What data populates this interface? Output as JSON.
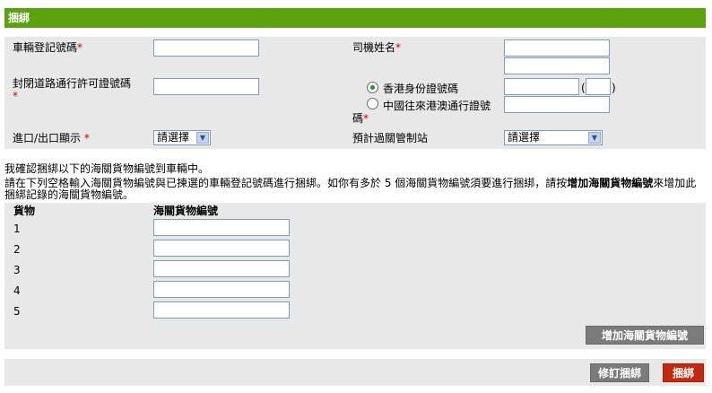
{
  "header": {
    "title": "捆綁"
  },
  "form": {
    "vehicle_reg_label": "車輛登記號碼",
    "driver_name_label": "司機姓名",
    "closed_road_permit_label": "封閉道路通行許可證號碼",
    "hkid_option_label": "香港身份證號碼",
    "china_permit_option_label": "中國往來港澳通行證號碼",
    "entry_exit_label": "進口/出口顯示",
    "control_point_label": "預計過關管制站",
    "select_placeholder": "請選擇",
    "required_mark": "*",
    "hkid_open_paren": "(",
    "hkid_close_paren": ")"
  },
  "messages": {
    "confirm": "我確認捆綁以下的海關貨物編號到車輛中。",
    "instruction_prefix": "請在下列空格輸入海關貨物編號與已揀選的車輛登記號碼進行捆綁。如你有多於 5 個海關貨物編號須要進行捆綁，請按",
    "instruction_link": "增加海關貨物編號",
    "instruction_suffix": "來增加此捆綁記錄的海關貨物編號。"
  },
  "goods": {
    "col_item": "貨物",
    "col_number": "海關貨物編號",
    "rows": [
      "1",
      "2",
      "3",
      "4",
      "5"
    ]
  },
  "buttons": {
    "add_goods": "增加海關貨物編號",
    "amend_binding": "修訂捆綁",
    "bind": "捆綁"
  },
  "colors": {
    "header_green": "#5aa20e",
    "panel_grey": "#e8e8e8",
    "button_grey": "#7b7b7b",
    "button_red": "#c12a11",
    "required_red": "#d00000"
  }
}
